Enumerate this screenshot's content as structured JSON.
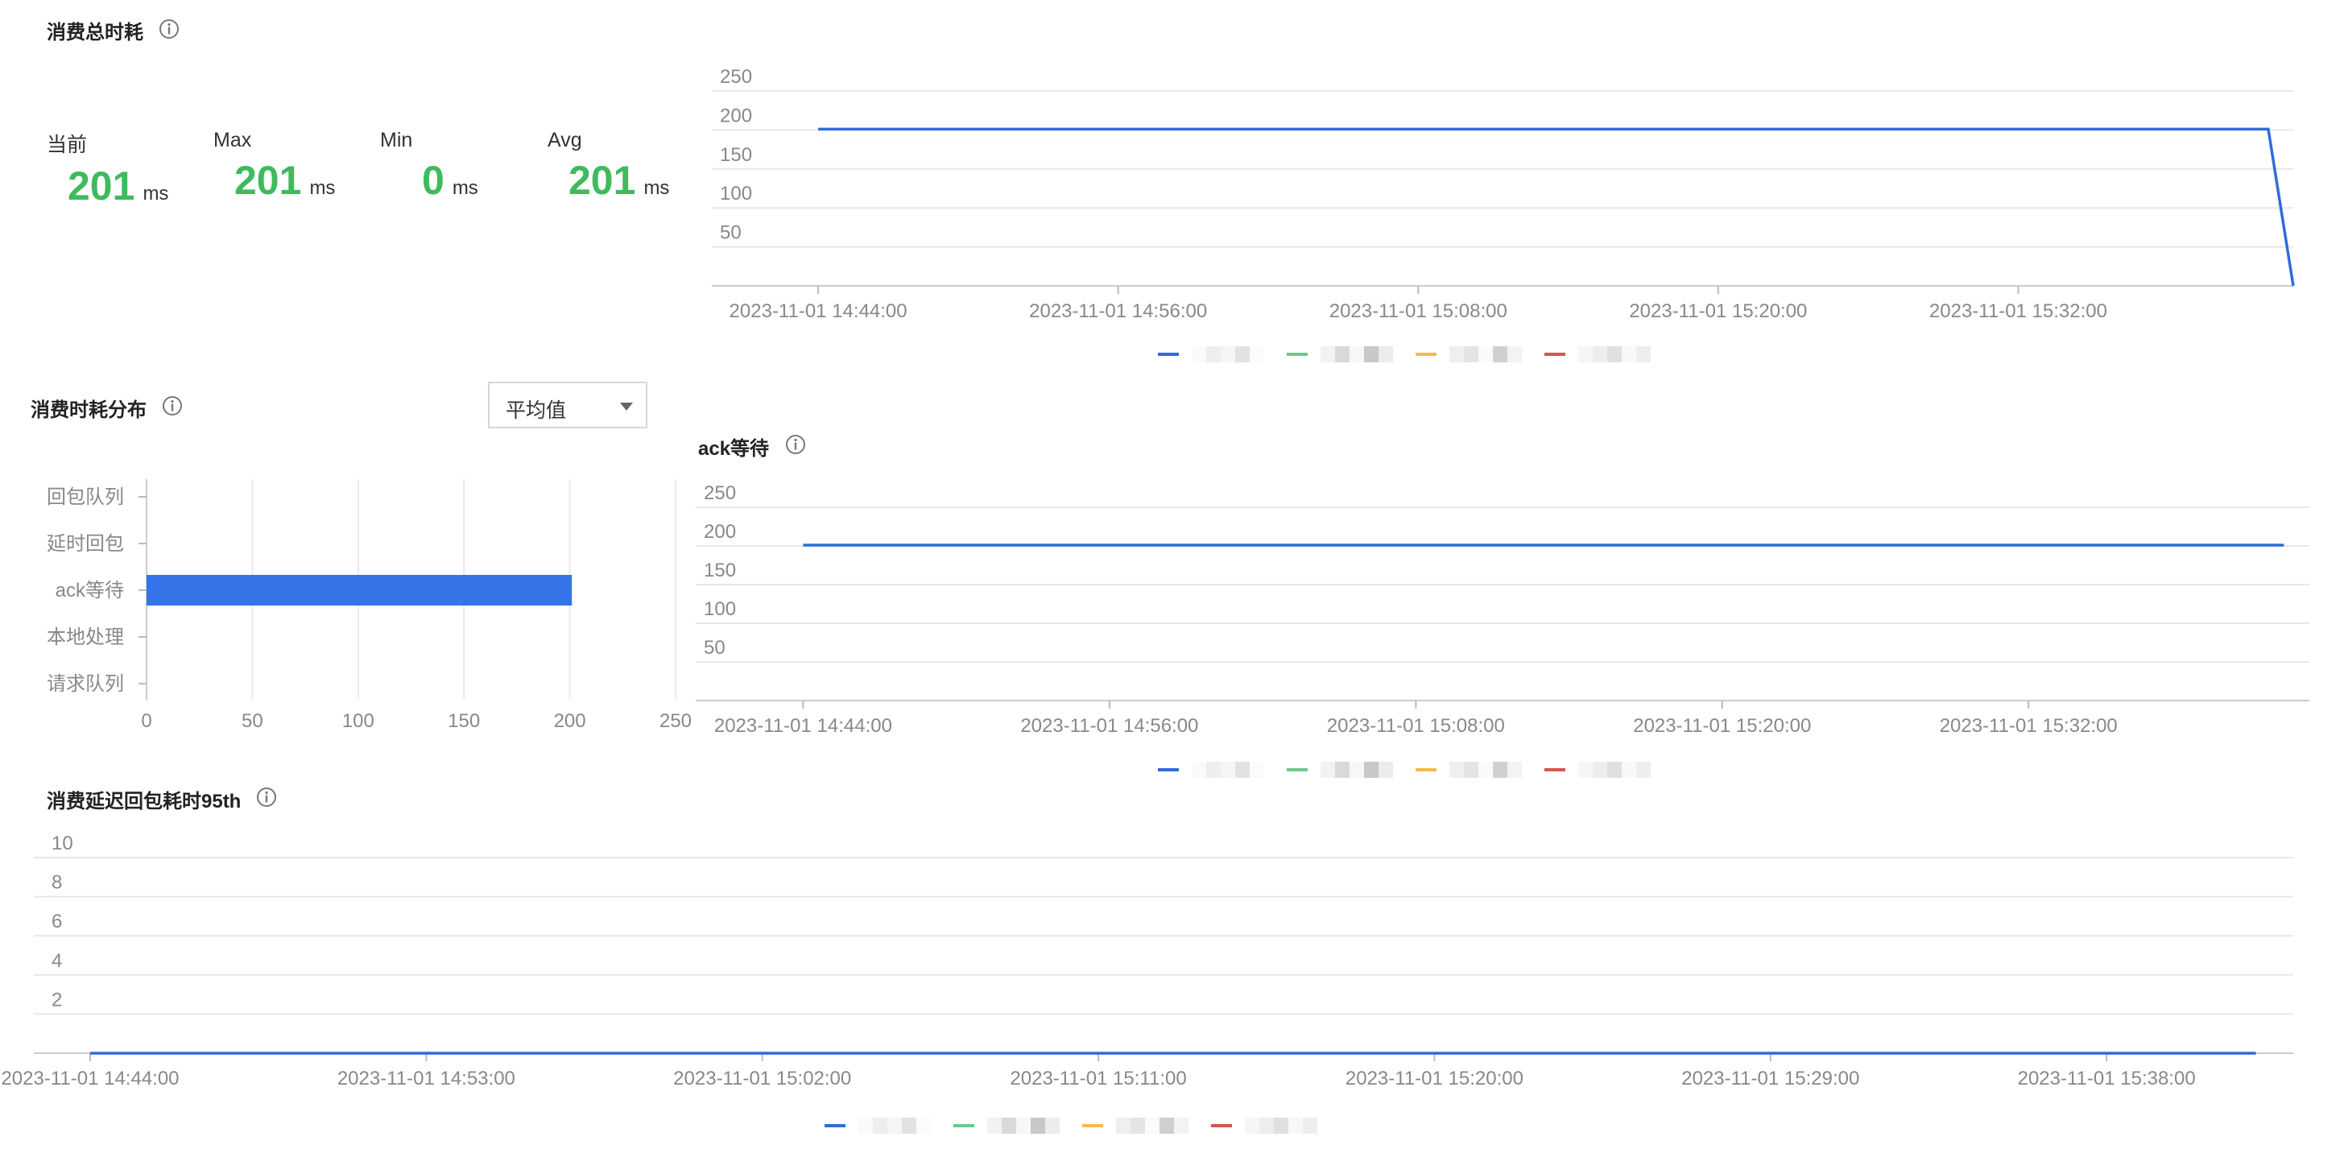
{
  "total": {
    "title": "消费总时耗",
    "stats": [
      {
        "label": "当前",
        "value": "201",
        "unit": "ms"
      },
      {
        "label": "Max",
        "value": "201",
        "unit": "ms"
      },
      {
        "label": "Min",
        "value": "0",
        "unit": "ms"
      },
      {
        "label": "Avg",
        "value": "201",
        "unit": "ms"
      }
    ],
    "chart_data": {
      "type": "line",
      "x_ticks": [
        "2023-11-01 14:44:00",
        "2023-11-01 14:56:00",
        "2023-11-01 15:08:00",
        "2023-11-01 15:20:00",
        "2023-11-01 15:32:00"
      ],
      "y_ticks": [
        "50",
        "100",
        "150",
        "200",
        "250"
      ],
      "ylim": [
        0,
        250
      ],
      "xlim": [
        "2023-11-01 14:42:00",
        "2023-11-01 15:43:00"
      ],
      "series": [
        {
          "color": "#2f6bdc",
          "points": [
            [
              "2023-11-01 14:44:00",
              201
            ],
            [
              "2023-11-01 15:42:00",
              201
            ],
            [
              "2023-11-01 15:43:00",
              0
            ]
          ]
        }
      ],
      "legend_colors": [
        "#2f6bdc",
        "#6cc88a",
        "#f5b94a",
        "#d9534f"
      ]
    }
  },
  "distribution": {
    "title": "消费时耗分布",
    "select_value": "平均值",
    "chart_data": {
      "type": "bar",
      "orientation": "horizontal",
      "categories": [
        "回包队列",
        "延时回包",
        "ack等待",
        "本地处理",
        "请求队列"
      ],
      "values": [
        0,
        0,
        201,
        0,
        0
      ],
      "x_ticks": [
        "0",
        "50",
        "100",
        "150",
        "200",
        "250"
      ],
      "xlim": [
        0,
        250
      ],
      "color": "#3773e8"
    }
  },
  "ack": {
    "title": "ack等待",
    "chart_data": {
      "type": "line",
      "x_ticks": [
        "2023-11-01 14:44:00",
        "2023-11-01 14:56:00",
        "2023-11-01 15:08:00",
        "2023-11-01 15:20:00",
        "2023-11-01 15:32:00"
      ],
      "y_ticks": [
        "50",
        "100",
        "150",
        "200",
        "250"
      ],
      "ylim": [
        0,
        250
      ],
      "xlim": [
        "2023-11-01 14:42:00",
        "2023-11-01 15:43:00"
      ],
      "series": [
        {
          "color": "#2f6bdc",
          "points": [
            [
              "2023-11-01 14:44:00",
              201
            ],
            [
              "2023-11-01 15:42:00",
              201
            ]
          ]
        }
      ],
      "legend_colors": [
        "#2f6bdc",
        "#6cc88a",
        "#f5b94a",
        "#d9534f"
      ]
    }
  },
  "p95": {
    "title": "消费延迟回包耗时95th",
    "chart_data": {
      "type": "line",
      "x_ticks": [
        "2023-11-01 14:44:00",
        "2023-11-01 14:53:00",
        "2023-11-01 15:02:00",
        "2023-11-01 15:11:00",
        "2023-11-01 15:20:00",
        "2023-11-01 15:29:00",
        "2023-11-01 15:38:00"
      ],
      "y_ticks": [
        "2",
        "4",
        "6",
        "8",
        "10"
      ],
      "ylim": [
        0,
        10
      ],
      "xlim": [
        "2023-11-01 14:44:00",
        "2023-11-01 15:43:00"
      ],
      "series": [
        {
          "color": "#2f6bdc",
          "points": [
            [
              "2023-11-01 14:44:00",
              0
            ],
            [
              "2023-11-01 15:42:00",
              0
            ]
          ]
        }
      ],
      "legend_colors": [
        "#2f6bdc",
        "#6cc88a",
        "#f5b94a",
        "#d9534f"
      ]
    }
  }
}
